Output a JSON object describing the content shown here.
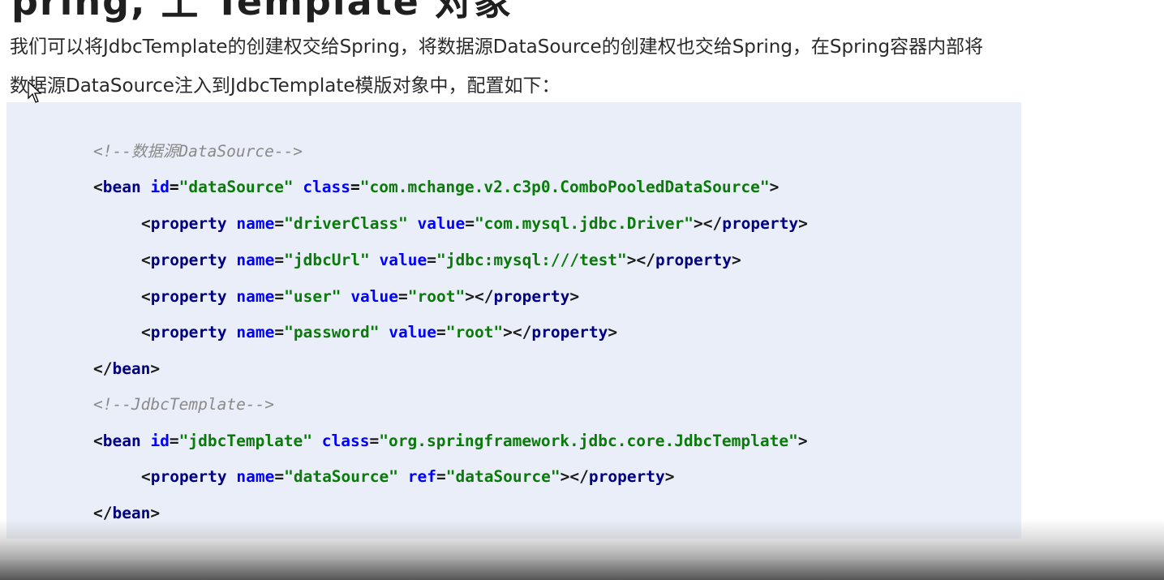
{
  "heading_fragment": "pring, 土     Template 对象",
  "intro": {
    "line1": "我们可以将JdbcTemplate的创建权交给Spring，将数据源DataSource的创建权也交给Spring，在Spring容器内部将",
    "line2": "数据源DataSource注入到JdbcTemplate模版对象中，配置如下："
  },
  "code": {
    "comment1": "<!--数据源DataSource-->",
    "bean1": {
      "id_value": "\"dataSource\"",
      "class_value": "\"com.mchange.v2.c3p0.ComboPooledDataSource\"",
      "properties": [
        {
          "name": "\"driverClass\"",
          "value_attr": "value",
          "value": "\"com.mysql.jdbc.Driver\""
        },
        {
          "name": "\"jdbcUrl\"",
          "value_attr": "value",
          "value": "\"jdbc:mysql:///test\""
        },
        {
          "name": "\"user\"",
          "value_attr": "value",
          "value": "\"root\""
        },
        {
          "name": "\"password\"",
          "value_attr": "value",
          "value": "\"root\""
        }
      ]
    },
    "comment2": "<!--JdbcTemplate-->",
    "bean2": {
      "id_value": "\"jdbcTemplate\"",
      "class_value": "\"org.springframework.jdbc.core.JdbcTemplate\"",
      "properties": [
        {
          "name": "\"dataSource\"",
          "value_attr": "ref",
          "value": "\"dataSource\""
        }
      ]
    },
    "tokens": {
      "lt": "<",
      "gt": ">",
      "lt_slash": "</",
      "eq": "=",
      "bean": "bean",
      "property": "property",
      "id": "id",
      "class": "class",
      "name": "name"
    }
  },
  "colors": {
    "code_background": "#e9eef8",
    "tag": "#000080",
    "attribute": "#0000ff",
    "string": "#0a7a0a",
    "comment": "#8a8a8a"
  }
}
